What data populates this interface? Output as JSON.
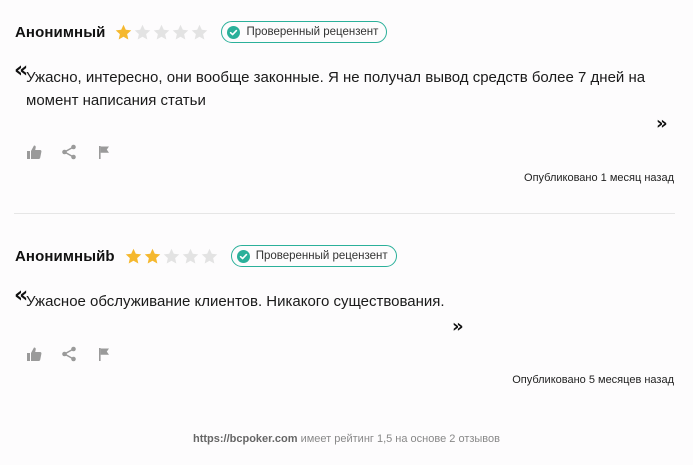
{
  "reviews": [
    {
      "author": "Анонимный",
      "rating": 1,
      "max_rating": 5,
      "badge": "Проверенный рецензент",
      "text": "Ужасно, интересно, они вообще законные. Я не получал вывод средств более 7 дней на момент написания статьи",
      "published": "Опубликовано 1 месяц назад"
    },
    {
      "author": "Анонимныйb",
      "rating": 2,
      "max_rating": 5,
      "badge": "Проверенный рецензент",
      "text": "Ужасное обслуживание клиентов. Никакого существования.",
      "published": "Опубликовано 5 месяцев назад"
    }
  ],
  "quotes": {
    "open": "«",
    "close": "»"
  },
  "footer": {
    "site": "https://bcpoker.com",
    "text": " имеет рейтинг 1,5 на основе 2 отзывов"
  },
  "colors": {
    "star_filled": "#f5b82e",
    "star_empty": "#e3e3e3",
    "badge_accent": "#2bb09a",
    "icon_gray": "#9a9a9a"
  },
  "icons": [
    "thumbs-up-icon",
    "share-icon",
    "flag-icon",
    "check-circle-icon",
    "star-icon"
  ]
}
